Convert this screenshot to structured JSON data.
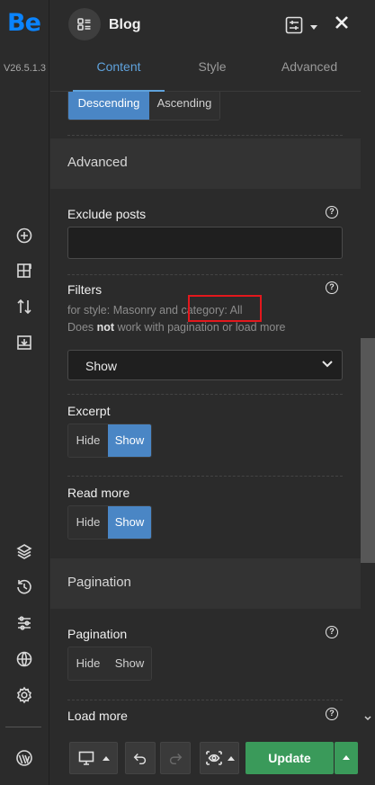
{
  "app": {
    "logo": "Be",
    "version": "V26.5.1.3"
  },
  "rail": {
    "icons": [
      "add-icon",
      "layout-add-icon",
      "sort-icon",
      "import-icon",
      "layers-icon",
      "history-icon",
      "settings-sliders-icon",
      "globe-icon",
      "gear-icon",
      "wordpress-icon"
    ]
  },
  "header": {
    "title": "Blog",
    "badge_icon": "blog-widget-icon",
    "settings_icon": "sliders-icon",
    "close_icon": "close-icon"
  },
  "tabs": [
    {
      "label": "Content",
      "active": true
    },
    {
      "label": "Style",
      "active": false
    },
    {
      "label": "Advanced",
      "active": false
    }
  ],
  "order": {
    "options": [
      "Descending",
      "Ascending"
    ],
    "selected": "Descending"
  },
  "section_advanced": {
    "title": "Advanced"
  },
  "exclude_posts": {
    "label": "Exclude posts",
    "value": ""
  },
  "filters": {
    "label": "Filters",
    "note1_pre": "for style: Masonry and ",
    "note1_highlight": "category: All",
    "note2_pre": "Does ",
    "note2_bold": "not",
    "note2_post": " work with pagination or load more",
    "selected": "Show"
  },
  "excerpt": {
    "label": "Excerpt",
    "options": [
      "Hide",
      "Show"
    ],
    "selected": "Show"
  },
  "read_more": {
    "label": "Read more",
    "options": [
      "Hide",
      "Show"
    ],
    "selected": "Show"
  },
  "section_pagination": {
    "title": "Pagination"
  },
  "pagination": {
    "label": "Pagination",
    "options": [
      "Hide",
      "Show"
    ],
    "selected": "none"
  },
  "load_more": {
    "label": "Load more"
  },
  "footer": {
    "update_label": "Update"
  },
  "colors": {
    "accent": "#4a86c5",
    "update": "#3a9a5a",
    "highlight_box": "#e3181d"
  }
}
